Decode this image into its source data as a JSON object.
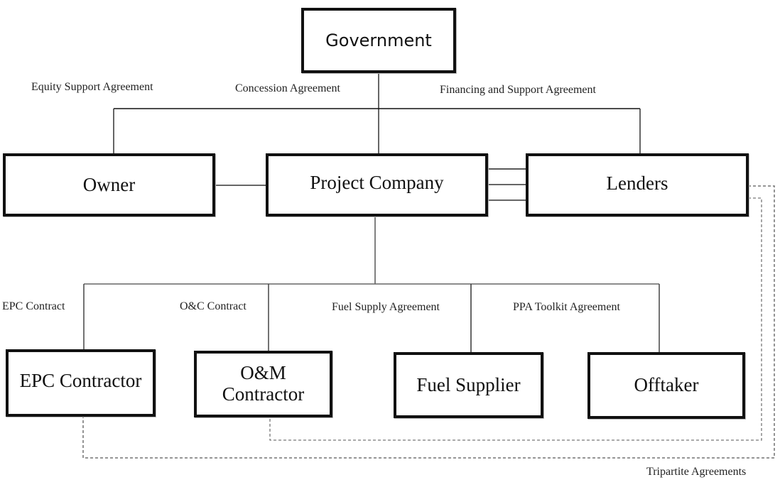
{
  "diagram": {
    "nodes": {
      "government": "Government",
      "owner": "Owner",
      "project_company": "Project Company",
      "lenders": "Lenders",
      "epc_contractor": "EPC Contractor",
      "om_contractor_line1": "O&M",
      "om_contractor_line2": "Contractor",
      "fuel_supplier": "Fuel Supplier",
      "offtaker": "Offtaker"
    },
    "edge_labels": {
      "equity_support": "Equity Support Agreement",
      "concession": "Concession Agreement",
      "financing_support": "Financing and Support Agreement",
      "epc_contract": "EPC Contract",
      "om_contract": "O&C Contract",
      "fuel_supply": "Fuel Supply Agreement",
      "ppa_toolkit": "PPA Toolkit Agreement",
      "tripartite": "Tripartite Agreements"
    },
    "edges": [
      {
        "from": "government",
        "to": "project_company",
        "label": "Concession Agreement",
        "style": "solid"
      },
      {
        "from": "owner",
        "to": "lenders",
        "label": "Equity Support Agreement / Financing and Support Agreement",
        "style": "solid"
      },
      {
        "from": "owner",
        "to": "project_company",
        "style": "solid"
      },
      {
        "from": "project_company",
        "to": "lenders",
        "style": "solid-triple"
      },
      {
        "from": "project_company",
        "to": "epc_contractor",
        "label": "EPC Contract",
        "style": "solid"
      },
      {
        "from": "project_company",
        "to": "om_contractor",
        "label": "O&C Contract",
        "style": "solid"
      },
      {
        "from": "project_company",
        "to": "fuel_supplier",
        "label": "Fuel Supply Agreement",
        "style": "solid"
      },
      {
        "from": "project_company",
        "to": "offtaker",
        "label": "PPA Toolkit Agreement",
        "style": "solid"
      },
      {
        "from": "lenders",
        "to": "epc_contractor",
        "label": "Tripartite Agreements",
        "style": "dashed"
      },
      {
        "from": "lenders",
        "to": "om_contractor",
        "label": "Tripartite Agreements",
        "style": "dashed"
      }
    ],
    "colors": {
      "box_border": "#111111",
      "solid_line": "#333333",
      "dashed_line": "#777777"
    }
  }
}
